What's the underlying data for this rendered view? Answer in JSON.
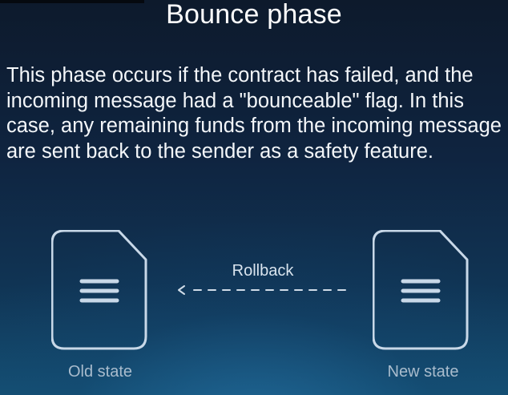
{
  "slide": {
    "title": "Bounce phase",
    "description": "This phase occurs if the contract has failed, and the incoming message had a \"bounceable\" flag. In this case, any remaining funds from the incoming message are sent back to the sender as a safety feature."
  },
  "diagram": {
    "arrow_label": "Rollback",
    "left_node": {
      "label": "Old state",
      "icon": "document-icon"
    },
    "right_node": {
      "label": "New state",
      "icon": "document-icon"
    },
    "arrow_direction": "right-to-left",
    "arrow_style": "dashed"
  },
  "colors": {
    "icon_stroke": "#c8d8e8",
    "caption": "#a9bccd",
    "text": "#ffffff",
    "background_top": "#0d1a2c",
    "background_bottom": "#145074"
  }
}
